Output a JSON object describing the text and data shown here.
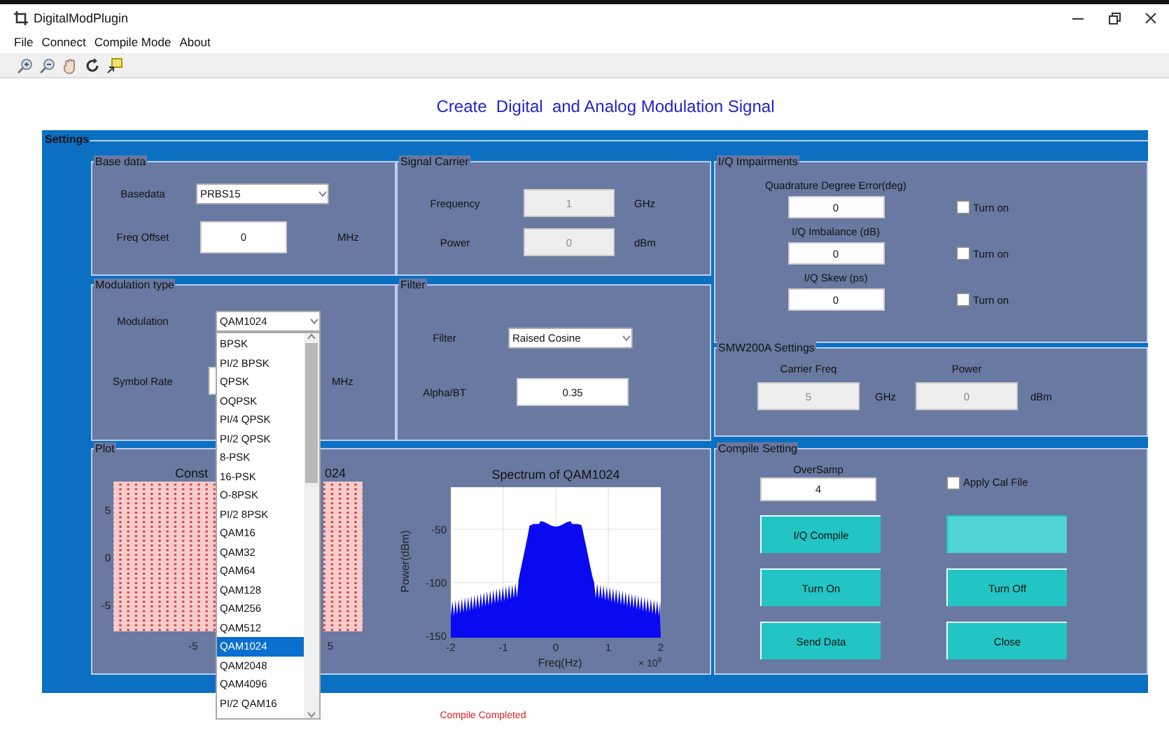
{
  "window": {
    "title": "DigitalModPlugin"
  },
  "menu": [
    "File",
    "Connect",
    "Compile Mode",
    "About"
  ],
  "heading": "Create  Digital  and Analog Modulation Signal",
  "settings": {
    "title": "Settings",
    "base_data": {
      "title": "Base data",
      "basedata": {
        "label": "Basedata",
        "value": "PRBS15"
      },
      "freq_offset": {
        "label": "Freq Offset",
        "value": "0",
        "unit": "MHz",
        "disabled": false
      }
    },
    "signal_carrier": {
      "title": "Signal  Carrier",
      "fields": [
        {
          "label": "Frequency",
          "value": "1",
          "unit": "GHz",
          "disabled": true
        },
        {
          "label": "Power",
          "value": "0",
          "unit": "dBm",
          "disabled": true
        }
      ]
    },
    "modulation_type": {
      "title": "Modulation type",
      "modulation": {
        "label": "Modulation",
        "value": "QAM1024",
        "expanded": true,
        "options": [
          {
            "label": "BPSK",
            "selected": false
          },
          {
            "label": "PI/2 BPSK",
            "selected": false
          },
          {
            "label": "QPSK",
            "selected": false
          },
          {
            "label": "OQPSK",
            "selected": false
          },
          {
            "label": "PI/4 QPSK",
            "selected": false
          },
          {
            "label": "PI/2 QPSK",
            "selected": false
          },
          {
            "label": "8-PSK",
            "selected": false
          },
          {
            "label": "16-PSK",
            "selected": false
          },
          {
            "label": "O-8PSK",
            "selected": false
          },
          {
            "label": "PI/2 8PSK",
            "selected": false
          },
          {
            "label": "QAM16",
            "selected": false
          },
          {
            "label": "QAM32",
            "selected": false
          },
          {
            "label": "QAM64",
            "selected": false
          },
          {
            "label": "QAM128",
            "selected": false
          },
          {
            "label": "QAM256",
            "selected": false
          },
          {
            "label": "QAM512",
            "selected": false
          },
          {
            "label": "QAM1024",
            "selected": true
          },
          {
            "label": "QAM2048",
            "selected": false
          },
          {
            "label": "QAM4096",
            "selected": false
          },
          {
            "label": "PI/2 QAM16",
            "selected": false
          }
        ]
      },
      "symbol_rate": {
        "label": "Symbol Rate",
        "unit": "MHz"
      }
    },
    "filter": {
      "title": "Filter",
      "filter": {
        "label": "Filter",
        "value": "Raised Cosine"
      },
      "alpha": {
        "label": "Alpha/BT",
        "value": "0.35",
        "disabled": false
      }
    },
    "iq_impairments": {
      "title": "I/Q Impairments",
      "items": [
        {
          "label": "Quadrature Degree Error(deg)",
          "value": "0",
          "toggle": "Turn on",
          "checked": false
        },
        {
          "label": "I/Q Imbalance (dB)",
          "value": "0",
          "toggle": "Turn on",
          "checked": false
        },
        {
          "label": "I/Q Skew (ps)",
          "value": "0",
          "toggle": "Turn on",
          "checked": false
        }
      ]
    },
    "smw_settings": {
      "title": "SMW200A Settings",
      "fields": [
        {
          "label": "Carrier Freq",
          "value": "5",
          "unit": "GHz",
          "disabled": true
        },
        {
          "label": "Power",
          "value": "0",
          "unit": "dBm",
          "disabled": true
        }
      ]
    },
    "plot": {
      "title": "Plot",
      "constellation": {
        "title_parts": [
          "Const",
          "024"
        ],
        "yticks": [
          "5",
          "0",
          "-5"
        ],
        "xticks": [
          "-5",
          "5"
        ]
      },
      "spectrum": {
        "title": "Spectrum of QAM1024",
        "ylabel": "Power(dBm)",
        "xlabel": "Freq(Hz)",
        "multiplier": "× 10$^{9}$",
        "yticks": [
          "-50",
          "-100",
          "-150"
        ],
        "xticks": [
          "-2",
          "-1",
          "0",
          "1",
          "2"
        ]
      }
    },
    "compile_setting": {
      "title": "Compile Setting",
      "oversamp": {
        "label": "OverSamp",
        "value": "4",
        "disabled": false
      },
      "apply_cal": {
        "label": "Apply Cal File",
        "checked": false
      },
      "buttons": [
        {
          "label": "I/Q Compile",
          "disabled": false
        },
        {
          "disabled": true
        },
        {
          "label": "Turn On",
          "disabled": false
        },
        {
          "label": "Turn Off",
          "disabled": false
        },
        {
          "label": "Send Data",
          "disabled": false
        },
        {
          "label": "Close",
          "disabled": false
        }
      ]
    }
  },
  "status": "Compile Completed"
}
